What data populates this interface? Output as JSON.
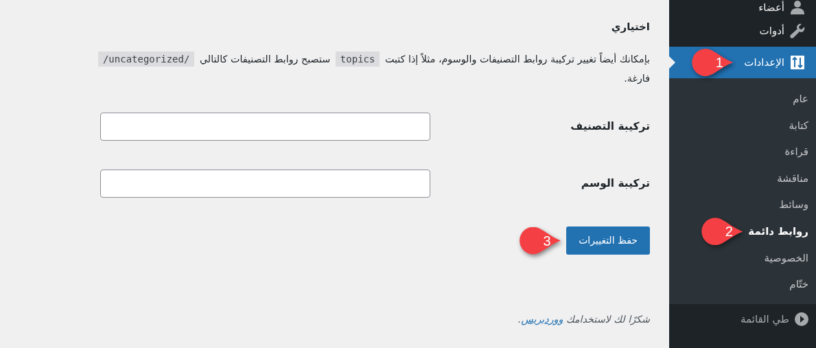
{
  "sidebar": {
    "items": [
      {
        "label": "أعضاء",
        "kind": "user",
        "selected": false
      },
      {
        "label": "أدوات",
        "kind": "wrench",
        "selected": false
      },
      {
        "label": "الإعدادات",
        "kind": "settings",
        "selected": true,
        "callout": "1",
        "submenu": [
          {
            "label": "عام",
            "selected": false
          },
          {
            "label": "كتابة",
            "selected": false
          },
          {
            "label": "قراءة",
            "selected": false
          },
          {
            "label": "مناقشة",
            "selected": false
          },
          {
            "label": "وسائط",
            "selected": false
          },
          {
            "label": "روابط دائمة",
            "selected": true,
            "callout": "2"
          },
          {
            "label": "الخصوصية",
            "selected": false
          },
          {
            "label": "ختّام",
            "selected": false
          }
        ]
      }
    ],
    "collapse": {
      "label": "طي القائمة"
    }
  },
  "main": {
    "section_title": "اختياري",
    "description": [
      [
        {
          "kind": "text",
          "text": "بإمكانك أيضاً تغيير تركيبة روابط التصنيفات والوسوم، مثلاً إذا كتبت "
        },
        {
          "kind": "code",
          "text": "topics"
        },
        {
          "kind": "text",
          "text": " ستصبح روابط التصنيفات كالتالي "
        },
        {
          "kind": "code",
          "text": "/uncategorized/"
        }
      ],
      [
        {
          "kind": "text",
          "text": "فارغة."
        }
      ]
    ],
    "fields": [
      {
        "label": "تركيبة التصنيف"
      },
      {
        "label": "تركيبة الوسم"
      }
    ],
    "save_button": {
      "label": "حفظ التغييرات",
      "callout": "3"
    },
    "footer": {
      "text": "شكرًا لك لاستخدامك ",
      "link": "ووردبريس",
      "end": "."
    }
  }
}
